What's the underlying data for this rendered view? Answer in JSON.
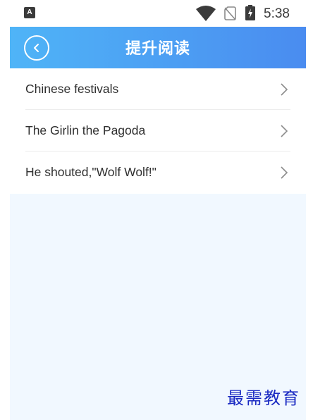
{
  "status_bar": {
    "app_icon_letter": "A",
    "wifi_icon": "wifi-icon",
    "sim_icon": "no-sim-icon",
    "battery_icon": "battery-charging-icon",
    "time": "5:38"
  },
  "header": {
    "back_icon": "back-circle-icon",
    "title": "提升阅读",
    "gradient_start": "#4fb4f7",
    "gradient_end": "#4a8cf0"
  },
  "list": {
    "items": [
      {
        "label": "Chinese festivals",
        "icon": "chevron-right-icon"
      },
      {
        "label": "The Girlin the Pagoda",
        "icon": "chevron-right-icon"
      },
      {
        "label": "He shouted,\"Wolf Wolf!\"",
        "icon": "chevron-right-icon"
      }
    ]
  },
  "watermark": {
    "text": "最需教育",
    "color": "#1a2ac2"
  },
  "colors": {
    "content_background": "#f1f8ff",
    "header_text": "#ffffff"
  }
}
